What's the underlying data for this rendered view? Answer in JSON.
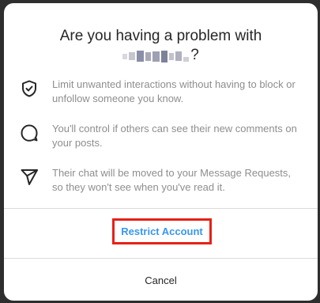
{
  "dialog": {
    "title_line1": "Are you having a problem with",
    "title_suffix": "?",
    "username_redacted_icon": "pixelated-username",
    "items": [
      {
        "icon": "shield-check-icon",
        "text": "Limit unwanted interactions without having to block or unfollow someone you know."
      },
      {
        "icon": "comment-bubble-icon",
        "text": "You'll control if others can see their new comments on your posts."
      },
      {
        "icon": "paper-plane-icon",
        "text": "Their chat will be moved to your Message Requests, so they won't see when you've read it."
      }
    ],
    "restrict_label": "Restrict Account",
    "cancel_label": "Cancel"
  },
  "colors": {
    "primary_link": "#3897f0",
    "highlight_box": "#e62117",
    "text_secondary": "#8e8e8e",
    "text_primary": "#262626"
  }
}
